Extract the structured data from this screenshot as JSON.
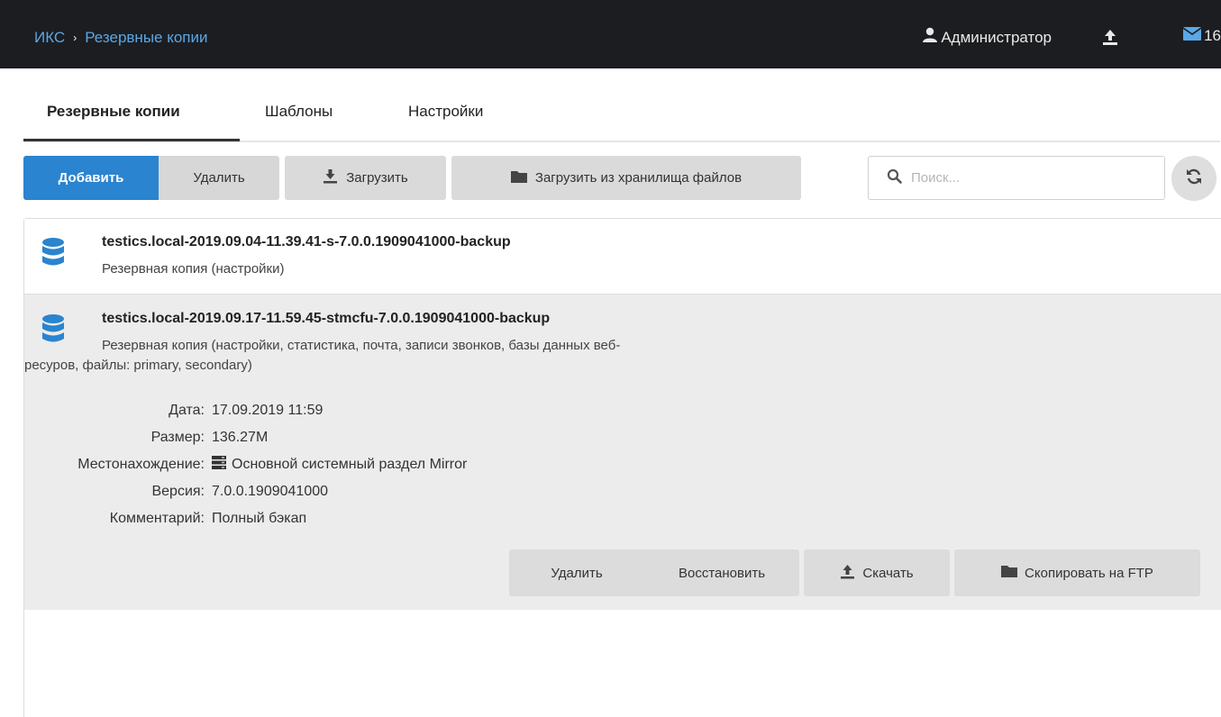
{
  "header": {
    "breadcrumb_root": "ИКС",
    "breadcrumb_separator": "›",
    "breadcrumb_current": "Резервные копии",
    "user_name": "Администратор",
    "mail_count": "16"
  },
  "tabs": [
    {
      "label": "Резервные копии",
      "active": true
    },
    {
      "label": "Шаблоны",
      "active": false
    },
    {
      "label": "Настройки",
      "active": false
    }
  ],
  "toolbar": {
    "add_label": "Добавить",
    "delete_label": "Удалить",
    "upload_label": "Загрузить",
    "upload_storage_label": "Загрузить из хранилища файлов",
    "search_placeholder": "Поиск..."
  },
  "backups": [
    {
      "name": "testics.local-2019.09.04-11.39.41-s-7.0.0.1909041000-backup",
      "description": "Резервная копия (настройки)"
    },
    {
      "name": "testics.local-2019.09.17-11.59.45-stmcfu-7.0.0.1909041000-backup",
      "description_line1": "Резервная копия (настройки, статистика, почта, записи звонков, базы данных веб-",
      "description_line2": "ресуров, файлы: primary, secondary)",
      "details": {
        "date_label": "Дата:",
        "date_value": "17.09.2019 11:59",
        "size_label": "Размер:",
        "size_value": "136.27M",
        "location_label": "Местонахождение:",
        "location_value": "Основной системный раздел Mirror",
        "version_label": "Версия:",
        "version_value": "7.0.0.1909041000",
        "comment_label": "Комментарий:",
        "comment_value": "Полный бэкап"
      },
      "actions": {
        "delete_label": "Удалить",
        "restore_label": "Восстановить",
        "download_label": "Скачать",
        "ftp_label": "Скопировать на FTP"
      }
    }
  ],
  "colors": {
    "topbar_bg": "#1c1d20",
    "link_blue": "#5aa8e6",
    "primary_button": "#2a84cf",
    "selected_row_bg": "#ececec"
  }
}
